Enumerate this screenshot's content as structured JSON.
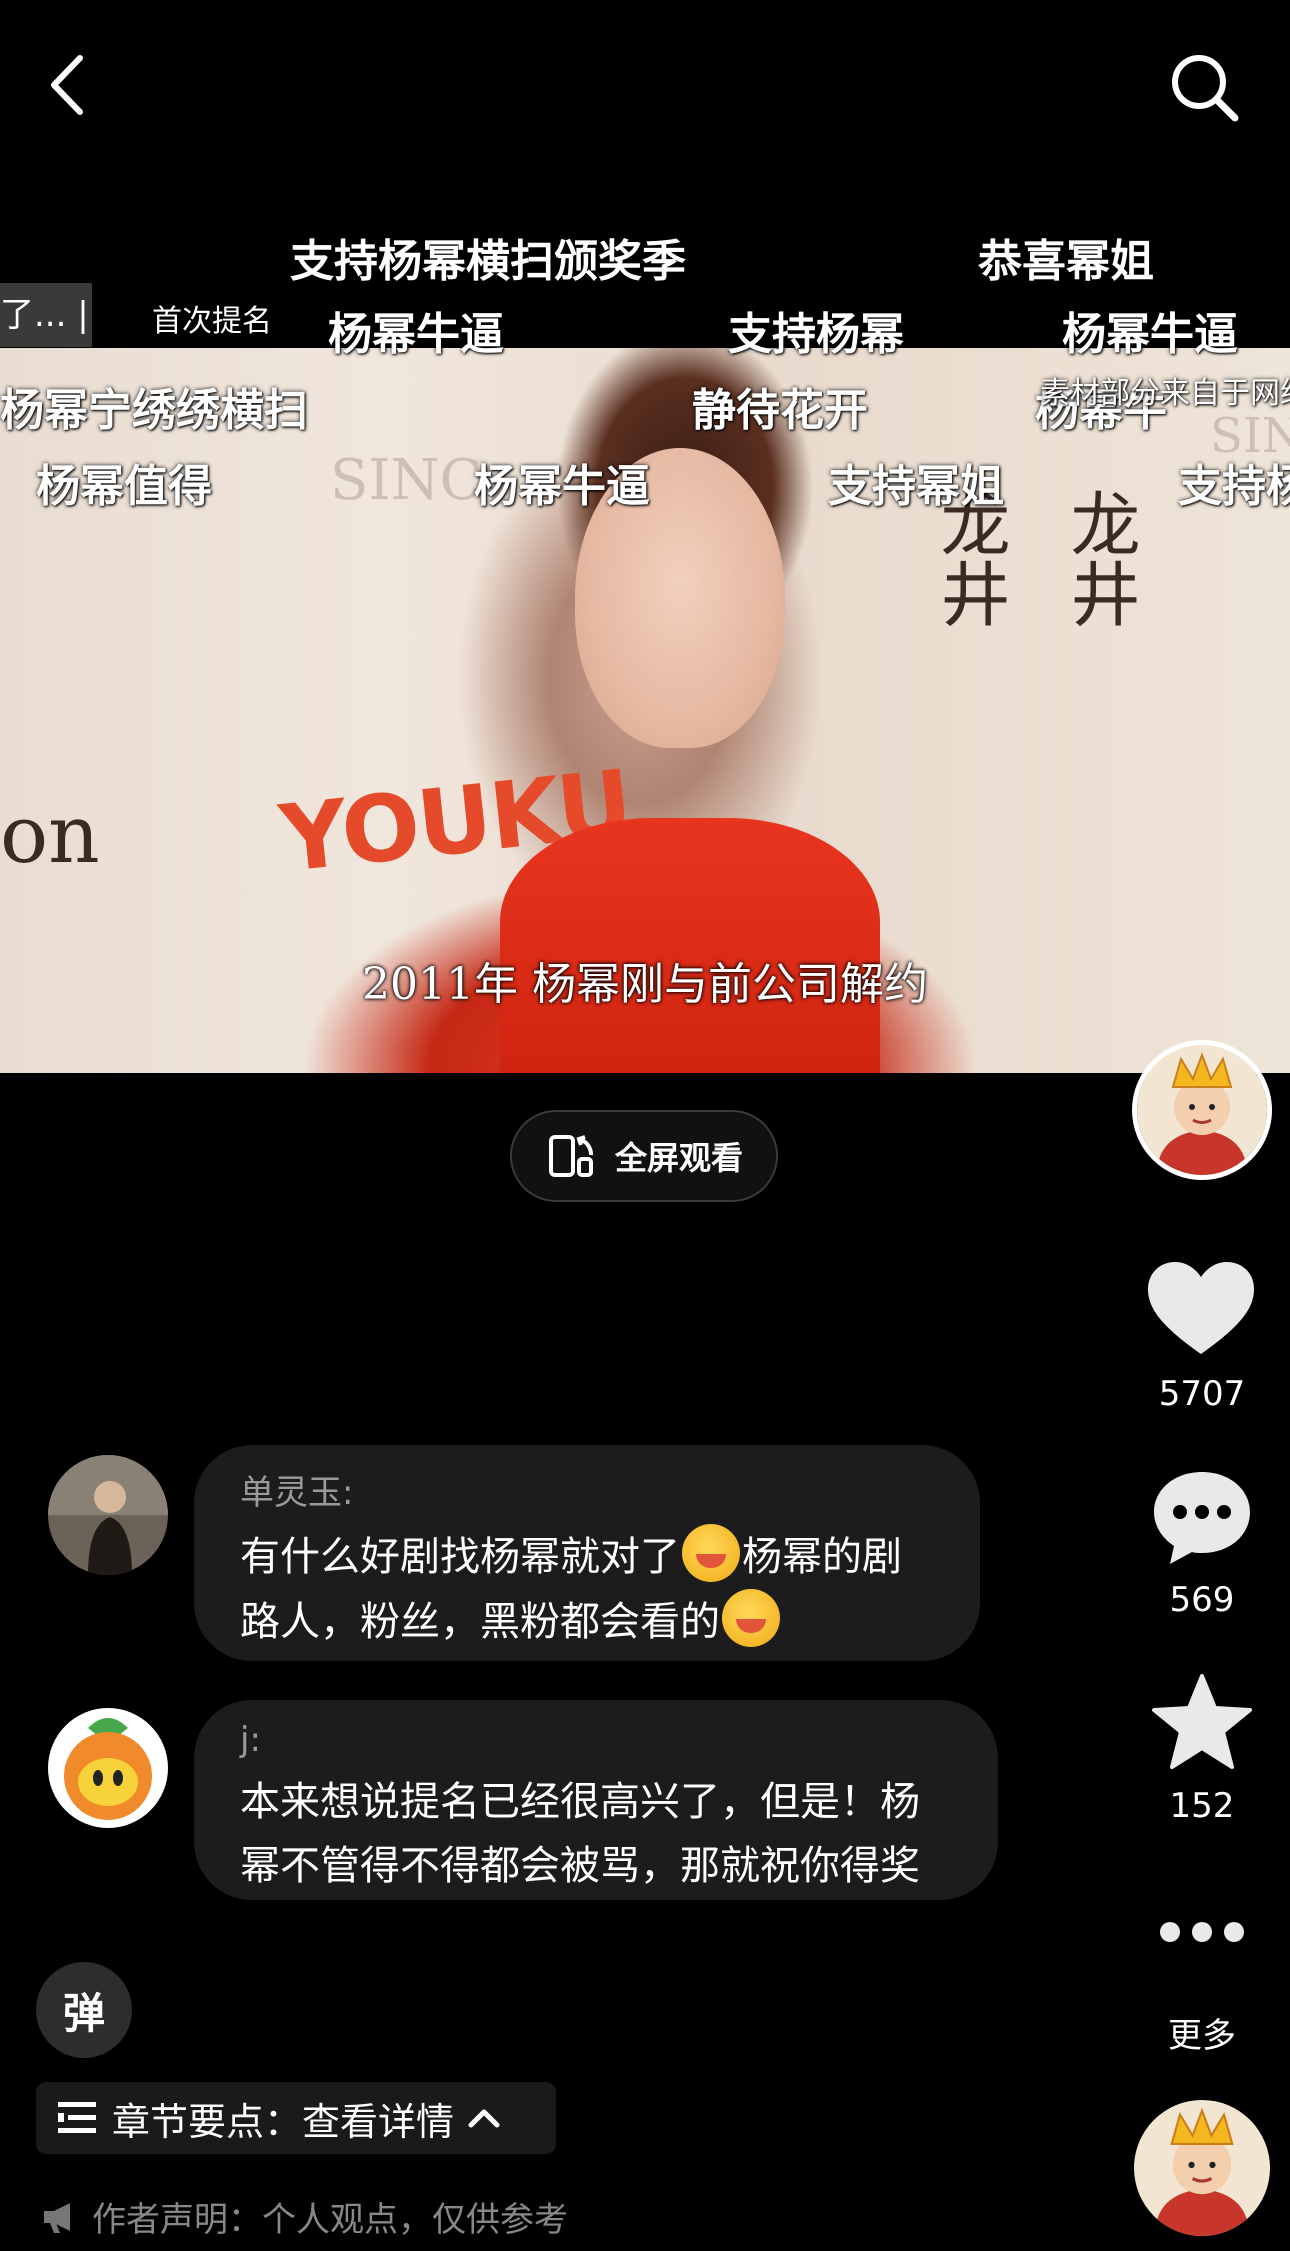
{
  "video": {
    "subtitle": "2011年 杨幂刚与前公司解约",
    "logo_text": "YOUKU",
    "wall_left": "on",
    "wall_right_1": "龙井",
    "wall_right_2": "龙井",
    "wall_sincere": "SINC"
  },
  "danmaku": [
    {
      "text": "支持杨幂横扫颁奖季",
      "small": false
    },
    {
      "text": "恭喜幂姐",
      "small": false
    },
    {
      "text": "首次提名",
      "small": true
    },
    {
      "text": "杨幂牛逼",
      "small": false
    },
    {
      "text": "支持杨幂",
      "small": false
    },
    {
      "text": "杨幂牛逼",
      "small": false
    },
    {
      "text": "杨幂宁绣绣横扫",
      "small": false
    },
    {
      "text": "静待花开",
      "small": false
    },
    {
      "text": "杨幂牛",
      "small": false
    },
    {
      "text": "素材部分来自于网络",
      "small": true
    },
    {
      "text": "杨幂值得",
      "small": false
    },
    {
      "text": "杨幂牛逼",
      "small": false
    },
    {
      "text": "支持幂姐",
      "small": false
    },
    {
      "text": "支持杨",
      "small": false
    }
  ],
  "danmaku_tag": "了... |",
  "fullscreen": {
    "label": "全屏观看"
  },
  "rail": {
    "like_count": "5707",
    "comment_count": "569",
    "star_count": "152",
    "more_label": "更多"
  },
  "comments": [
    {
      "user": "单灵玉:",
      "line1": "有什么好剧找杨幂就对了",
      "line1b": "杨幂的剧",
      "line2": "路人，粉丝，黑粉都会看的"
    },
    {
      "user": "j:",
      "line1": "本来想说提名已经很高兴了，但是！杨",
      "line2": "幂不管得不得都会被骂，那就祝你得奖"
    }
  ],
  "bottom": {
    "danmu_label": "弹",
    "chapter_label": "章节要点：查看详情",
    "disclaimer": "作者声明：个人观点，仅供参考"
  }
}
